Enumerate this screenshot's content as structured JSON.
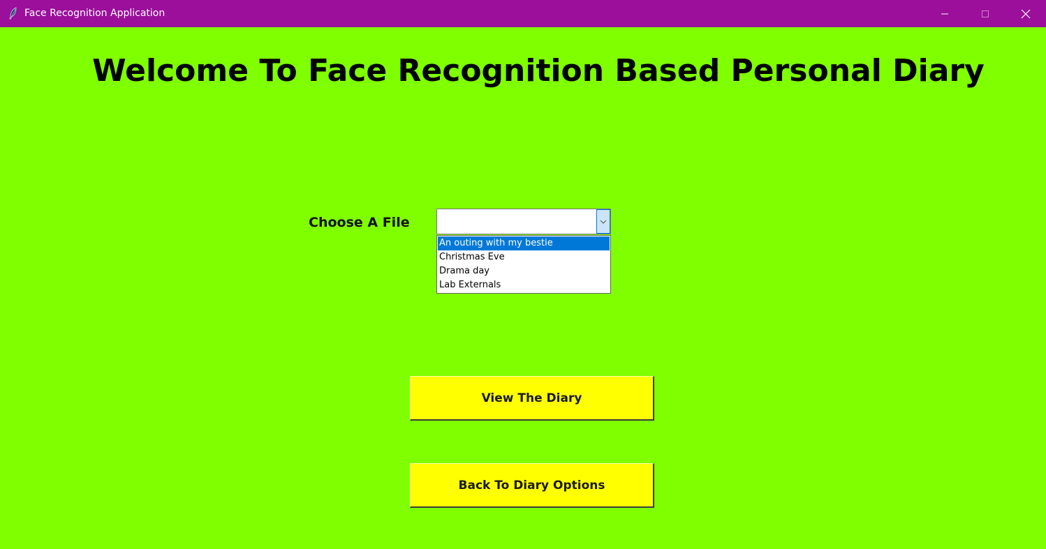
{
  "window": {
    "title": "Face Recognition Application",
    "app_icon": "feather-icon",
    "controls": {
      "minimize_icon": "minimize-icon",
      "maximize_icon": "maximize-icon",
      "close_icon": "close-icon"
    },
    "titlebar_color": "#9b0f9b",
    "background_color": "#7fff00"
  },
  "main": {
    "heading": "Welcome To Face Recognition Based Personal Diary",
    "choose_label": "Choose A File",
    "file_select": {
      "value": "",
      "arrow_icon": "chevron-down-icon",
      "options": [
        "An outing with my bestie",
        "Christmas Eve",
        "Drama day",
        "Lab Externals"
      ],
      "highlighted_option": "An outing with my bestie"
    },
    "view_button_label": "View The Diary",
    "back_button_label": "Back To Diary Options",
    "button_color": "#ffff00",
    "highlight_color": "#0078d7"
  }
}
